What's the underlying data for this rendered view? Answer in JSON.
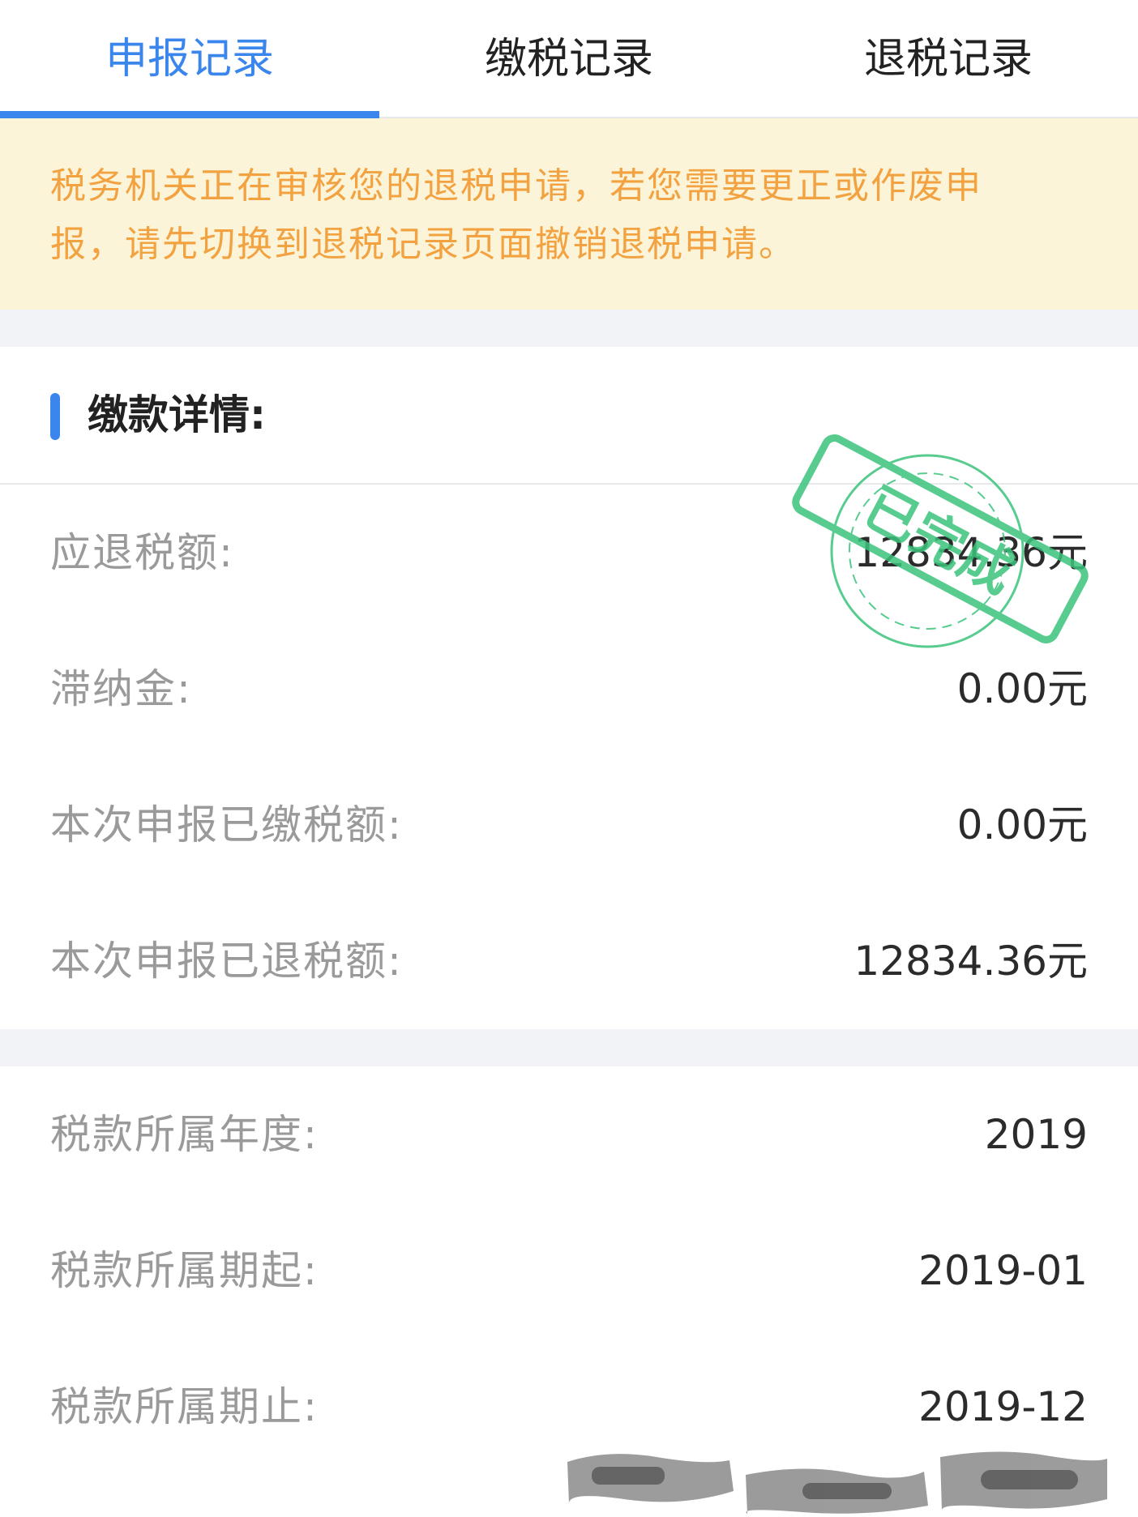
{
  "tabs": [
    {
      "label": "申报记录",
      "active": true
    },
    {
      "label": "缴税记录",
      "active": false
    },
    {
      "label": "退税记录",
      "active": false
    }
  ],
  "notice": {
    "line1": "税务机关正在审核您的退税申请，若您需要更正或作废申",
    "line2": "报，请先切换到退税记录页面撤销退税申请。"
  },
  "payment_section": {
    "title": "缴款详情:",
    "rows": [
      {
        "label": "应退税额:",
        "value": "12834.36元"
      },
      {
        "label": "滞纳金:",
        "value": "0.00元"
      },
      {
        "label": "本次申报已缴税额:",
        "value": "0.00元"
      },
      {
        "label": "本次申报已退税额:",
        "value": "12834.36元"
      }
    ]
  },
  "period_section": {
    "rows": [
      {
        "label": "税款所属年度:",
        "value": "2019"
      },
      {
        "label": "税款所属期起:",
        "value": "2019-01"
      },
      {
        "label": "税款所属期止:",
        "value": "2019-12"
      }
    ]
  },
  "stamp": {
    "text": "已完成",
    "color": "#3cc47c"
  },
  "colors": {
    "accent": "#3a86ec",
    "notice_text": "#f2a240",
    "notice_bg": "#fcf4d8",
    "label": "#9a9a9a",
    "value": "#2b2b2b"
  }
}
